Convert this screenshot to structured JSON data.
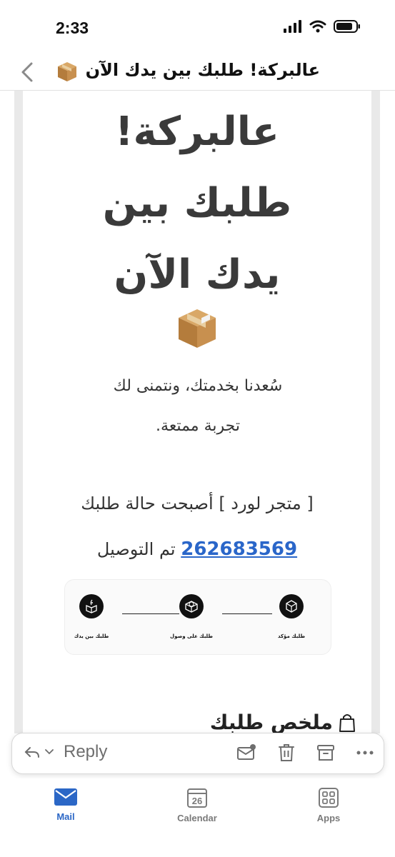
{
  "status_bar": {
    "time": "2:33"
  },
  "header": {
    "subject": "عالبركة! طلبك بين يدك الآن"
  },
  "email": {
    "headline": [
      "عالبركة!",
      "طلبك بين",
      "يدك الآن"
    ],
    "thanks_lines": [
      "سُعدنا بخدمتك، ونتمنى لك",
      "تجربة ممتعة."
    ],
    "status_line1": "[ متجر لورد ] أصبحت حالة طلبك",
    "order_number": "262683569",
    "status_suffix": "تم التوصيل",
    "tracker": [
      {
        "label": "طلبك مؤكد",
        "icon": "box-check-icon"
      },
      {
        "label": "طلبك على وصول",
        "icon": "box-globe-icon"
      },
      {
        "label": "طلبك بين يدك",
        "icon": "box-open-icon"
      }
    ],
    "summary_title": "ملخص طلبك"
  },
  "toolbar": {
    "reply_label": "Reply"
  },
  "tabs": [
    {
      "label": "Mail",
      "icon": "mail-icon",
      "active": true
    },
    {
      "label": "Calendar",
      "icon": "calendar-icon",
      "day": "26",
      "active": false
    },
    {
      "label": "Apps",
      "icon": "apps-grid-icon",
      "active": false
    }
  ],
  "colors": {
    "accent": "#2b67c6",
    "link": "#2a66c9",
    "text": "#3a3a3a"
  }
}
